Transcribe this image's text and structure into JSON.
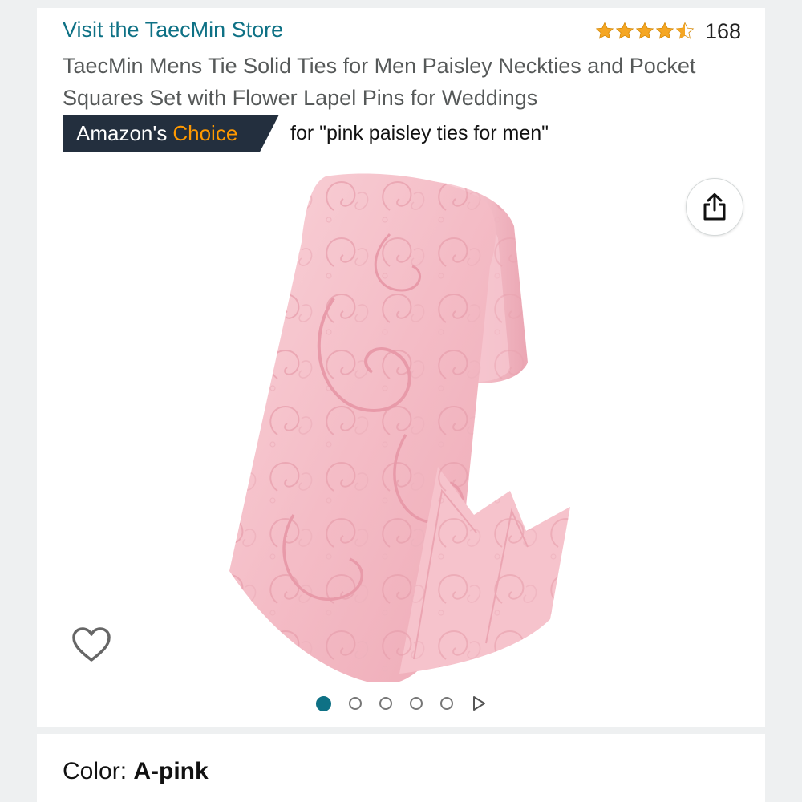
{
  "header": {
    "store_link": "Visit the TaecMin Store",
    "rating": {
      "stars": 4.5,
      "count": "168"
    },
    "title": "TaecMin Mens Tie Solid Ties for Men Paisley Neckties and Pocket Squares Set with Flower Lapel Pins for Weddings"
  },
  "badge": {
    "prefix": "Amazon's",
    "highlight": "Choice",
    "query": "for \"pink paisley ties for men\""
  },
  "gallery": {
    "image_total_dots": 5,
    "active_index": 0,
    "share_icon": "share-icon",
    "wishlist_icon": "heart-outline-icon",
    "video_icon": "play-triangle-icon"
  },
  "variation": {
    "label": "Color: ",
    "value": "A-pink"
  },
  "colors": {
    "link": "#0e7185",
    "badge_bg": "#232f3e",
    "badge_accent": "#ff9900",
    "star": "#f5a623",
    "product_pink": "#f4bcc6"
  }
}
